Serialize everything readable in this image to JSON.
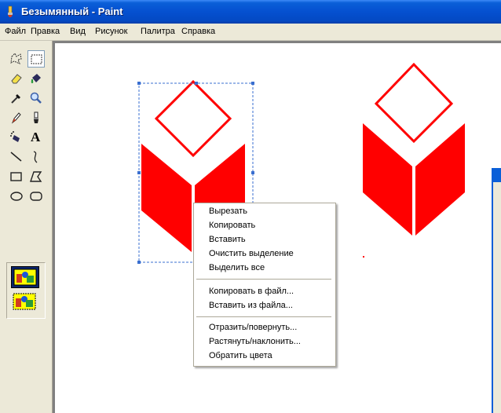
{
  "window": {
    "title": "Безымянный - Paint"
  },
  "menubar": [
    "Файл",
    "Правка",
    "Вид",
    "Рисунок",
    "Палитра",
    "Справка"
  ],
  "toolbox": {
    "tools": [
      {
        "name": "free-select-icon",
        "active": false
      },
      {
        "name": "rect-select-icon",
        "active": true
      },
      {
        "name": "eraser-icon",
        "active": false
      },
      {
        "name": "fill-bucket-icon",
        "active": false
      },
      {
        "name": "color-picker-icon",
        "active": false
      },
      {
        "name": "magnifier-icon",
        "active": false
      },
      {
        "name": "pencil-icon",
        "active": false
      },
      {
        "name": "brush-icon",
        "active": false
      },
      {
        "name": "airbrush-icon",
        "active": false
      },
      {
        "name": "text-icon",
        "active": false
      },
      {
        "name": "line-icon",
        "active": false
      },
      {
        "name": "curve-icon",
        "active": false
      },
      {
        "name": "rectangle-icon",
        "active": false
      },
      {
        "name": "polygon-icon",
        "active": false
      },
      {
        "name": "ellipse-icon",
        "active": false
      },
      {
        "name": "rounded-rectangle-icon",
        "active": false
      }
    ],
    "text_tool_glyph": "A",
    "options": [
      {
        "name": "opaque-selection-icon",
        "selected": true
      },
      {
        "name": "transparent-selection-icon",
        "selected": false
      }
    ]
  },
  "canvas": {
    "shape_color": "#ff0000",
    "selection_color": "#3a6fd0"
  },
  "context_menu": {
    "groups": [
      [
        "Вырезать",
        "Копировать",
        "Вставить",
        "Очистить выделение",
        "Выделить все"
      ],
      [
        "Копировать в файл...",
        "Вставить из файла..."
      ],
      [
        "Отразить/повернуть...",
        "Растянуть/наклонить...",
        "Обратить цвета"
      ]
    ]
  }
}
